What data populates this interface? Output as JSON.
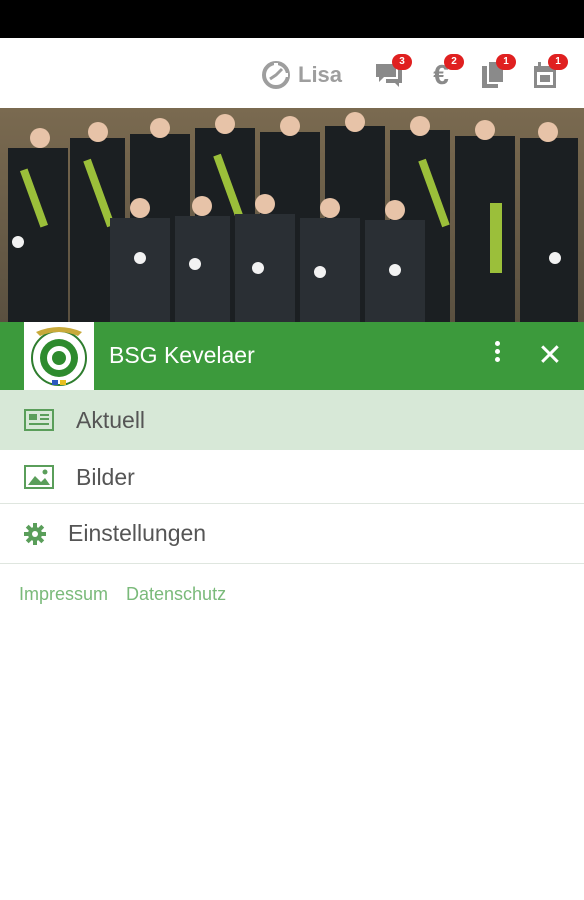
{
  "topbar": {
    "user_name": "Lisa",
    "icons": [
      {
        "name": "chat-icon",
        "badge": "3"
      },
      {
        "name": "euro-icon",
        "badge": "2"
      },
      {
        "name": "documents-icon",
        "badge": "1"
      },
      {
        "name": "calendar-icon",
        "badge": "1"
      }
    ]
  },
  "header": {
    "club_name": "BSG Kevelaer"
  },
  "menu": {
    "items": [
      {
        "label": "Aktuell",
        "icon": "newspaper-icon"
      },
      {
        "label": "Bilder",
        "icon": "image-icon"
      },
      {
        "label": "Einstellungen",
        "icon": "gear-icon"
      }
    ]
  },
  "footer": {
    "links": [
      "Impressum",
      "Datenschutz"
    ]
  },
  "colors": {
    "accent": "#3c9a3c",
    "selected_bg": "#d7e8d7",
    "link": "#7aba7a",
    "badge": "#e02020"
  }
}
